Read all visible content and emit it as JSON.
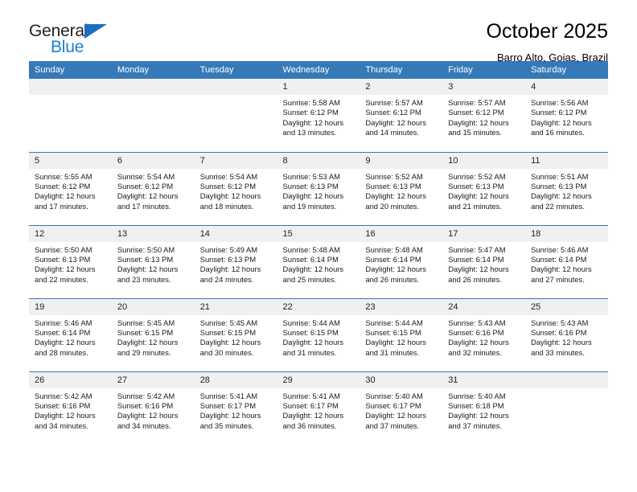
{
  "brand": {
    "name_top": "General",
    "name_bottom": "Blue",
    "accent_color": "#1b7fd4",
    "header_color": "#3579b8"
  },
  "header": {
    "title": "October 2025",
    "subtitle": "Barro Alto, Goias, Brazil"
  },
  "calendar": {
    "weekday_headers": [
      "Sunday",
      "Monday",
      "Tuesday",
      "Wednesday",
      "Thursday",
      "Friday",
      "Saturday"
    ],
    "labels": {
      "sunrise": "Sunrise:",
      "sunset": "Sunset:",
      "daylight": "Daylight:"
    },
    "weeks": [
      [
        {
          "day": "",
          "sunrise": "",
          "sunset": "",
          "daylight_1": "",
          "daylight_2": ""
        },
        {
          "day": "",
          "sunrise": "",
          "sunset": "",
          "daylight_1": "",
          "daylight_2": ""
        },
        {
          "day": "",
          "sunrise": "",
          "sunset": "",
          "daylight_1": "",
          "daylight_2": ""
        },
        {
          "day": "1",
          "sunrise": "Sunrise: 5:58 AM",
          "sunset": "Sunset: 6:12 PM",
          "daylight_1": "Daylight: 12 hours",
          "daylight_2": "and 13 minutes."
        },
        {
          "day": "2",
          "sunrise": "Sunrise: 5:57 AM",
          "sunset": "Sunset: 6:12 PM",
          "daylight_1": "Daylight: 12 hours",
          "daylight_2": "and 14 minutes."
        },
        {
          "day": "3",
          "sunrise": "Sunrise: 5:57 AM",
          "sunset": "Sunset: 6:12 PM",
          "daylight_1": "Daylight: 12 hours",
          "daylight_2": "and 15 minutes."
        },
        {
          "day": "4",
          "sunrise": "Sunrise: 5:56 AM",
          "sunset": "Sunset: 6:12 PM",
          "daylight_1": "Daylight: 12 hours",
          "daylight_2": "and 16 minutes."
        }
      ],
      [
        {
          "day": "5",
          "sunrise": "Sunrise: 5:55 AM",
          "sunset": "Sunset: 6:12 PM",
          "daylight_1": "Daylight: 12 hours",
          "daylight_2": "and 17 minutes."
        },
        {
          "day": "6",
          "sunrise": "Sunrise: 5:54 AM",
          "sunset": "Sunset: 6:12 PM",
          "daylight_1": "Daylight: 12 hours",
          "daylight_2": "and 17 minutes."
        },
        {
          "day": "7",
          "sunrise": "Sunrise: 5:54 AM",
          "sunset": "Sunset: 6:12 PM",
          "daylight_1": "Daylight: 12 hours",
          "daylight_2": "and 18 minutes."
        },
        {
          "day": "8",
          "sunrise": "Sunrise: 5:53 AM",
          "sunset": "Sunset: 6:13 PM",
          "daylight_1": "Daylight: 12 hours",
          "daylight_2": "and 19 minutes."
        },
        {
          "day": "9",
          "sunrise": "Sunrise: 5:52 AM",
          "sunset": "Sunset: 6:13 PM",
          "daylight_1": "Daylight: 12 hours",
          "daylight_2": "and 20 minutes."
        },
        {
          "day": "10",
          "sunrise": "Sunrise: 5:52 AM",
          "sunset": "Sunset: 6:13 PM",
          "daylight_1": "Daylight: 12 hours",
          "daylight_2": "and 21 minutes."
        },
        {
          "day": "11",
          "sunrise": "Sunrise: 5:51 AM",
          "sunset": "Sunset: 6:13 PM",
          "daylight_1": "Daylight: 12 hours",
          "daylight_2": "and 22 minutes."
        }
      ],
      [
        {
          "day": "12",
          "sunrise": "Sunrise: 5:50 AM",
          "sunset": "Sunset: 6:13 PM",
          "daylight_1": "Daylight: 12 hours",
          "daylight_2": "and 22 minutes."
        },
        {
          "day": "13",
          "sunrise": "Sunrise: 5:50 AM",
          "sunset": "Sunset: 6:13 PM",
          "daylight_1": "Daylight: 12 hours",
          "daylight_2": "and 23 minutes."
        },
        {
          "day": "14",
          "sunrise": "Sunrise: 5:49 AM",
          "sunset": "Sunset: 6:13 PM",
          "daylight_1": "Daylight: 12 hours",
          "daylight_2": "and 24 minutes."
        },
        {
          "day": "15",
          "sunrise": "Sunrise: 5:48 AM",
          "sunset": "Sunset: 6:14 PM",
          "daylight_1": "Daylight: 12 hours",
          "daylight_2": "and 25 minutes."
        },
        {
          "day": "16",
          "sunrise": "Sunrise: 5:48 AM",
          "sunset": "Sunset: 6:14 PM",
          "daylight_1": "Daylight: 12 hours",
          "daylight_2": "and 26 minutes."
        },
        {
          "day": "17",
          "sunrise": "Sunrise: 5:47 AM",
          "sunset": "Sunset: 6:14 PM",
          "daylight_1": "Daylight: 12 hours",
          "daylight_2": "and 26 minutes."
        },
        {
          "day": "18",
          "sunrise": "Sunrise: 5:46 AM",
          "sunset": "Sunset: 6:14 PM",
          "daylight_1": "Daylight: 12 hours",
          "daylight_2": "and 27 minutes."
        }
      ],
      [
        {
          "day": "19",
          "sunrise": "Sunrise: 5:46 AM",
          "sunset": "Sunset: 6:14 PM",
          "daylight_1": "Daylight: 12 hours",
          "daylight_2": "and 28 minutes."
        },
        {
          "day": "20",
          "sunrise": "Sunrise: 5:45 AM",
          "sunset": "Sunset: 6:15 PM",
          "daylight_1": "Daylight: 12 hours",
          "daylight_2": "and 29 minutes."
        },
        {
          "day": "21",
          "sunrise": "Sunrise: 5:45 AM",
          "sunset": "Sunset: 6:15 PM",
          "daylight_1": "Daylight: 12 hours",
          "daylight_2": "and 30 minutes."
        },
        {
          "day": "22",
          "sunrise": "Sunrise: 5:44 AM",
          "sunset": "Sunset: 6:15 PM",
          "daylight_1": "Daylight: 12 hours",
          "daylight_2": "and 31 minutes."
        },
        {
          "day": "23",
          "sunrise": "Sunrise: 5:44 AM",
          "sunset": "Sunset: 6:15 PM",
          "daylight_1": "Daylight: 12 hours",
          "daylight_2": "and 31 minutes."
        },
        {
          "day": "24",
          "sunrise": "Sunrise: 5:43 AM",
          "sunset": "Sunset: 6:16 PM",
          "daylight_1": "Daylight: 12 hours",
          "daylight_2": "and 32 minutes."
        },
        {
          "day": "25",
          "sunrise": "Sunrise: 5:43 AM",
          "sunset": "Sunset: 6:16 PM",
          "daylight_1": "Daylight: 12 hours",
          "daylight_2": "and 33 minutes."
        }
      ],
      [
        {
          "day": "26",
          "sunrise": "Sunrise: 5:42 AM",
          "sunset": "Sunset: 6:16 PM",
          "daylight_1": "Daylight: 12 hours",
          "daylight_2": "and 34 minutes."
        },
        {
          "day": "27",
          "sunrise": "Sunrise: 5:42 AM",
          "sunset": "Sunset: 6:16 PM",
          "daylight_1": "Daylight: 12 hours",
          "daylight_2": "and 34 minutes."
        },
        {
          "day": "28",
          "sunrise": "Sunrise: 5:41 AM",
          "sunset": "Sunset: 6:17 PM",
          "daylight_1": "Daylight: 12 hours",
          "daylight_2": "and 35 minutes."
        },
        {
          "day": "29",
          "sunrise": "Sunrise: 5:41 AM",
          "sunset": "Sunset: 6:17 PM",
          "daylight_1": "Daylight: 12 hours",
          "daylight_2": "and 36 minutes."
        },
        {
          "day": "30",
          "sunrise": "Sunrise: 5:40 AM",
          "sunset": "Sunset: 6:17 PM",
          "daylight_1": "Daylight: 12 hours",
          "daylight_2": "and 37 minutes."
        },
        {
          "day": "31",
          "sunrise": "Sunrise: 5:40 AM",
          "sunset": "Sunset: 6:18 PM",
          "daylight_1": "Daylight: 12 hours",
          "daylight_2": "and 37 minutes."
        },
        {
          "day": "",
          "sunrise": "",
          "sunset": "",
          "daylight_1": "",
          "daylight_2": ""
        }
      ]
    ]
  }
}
